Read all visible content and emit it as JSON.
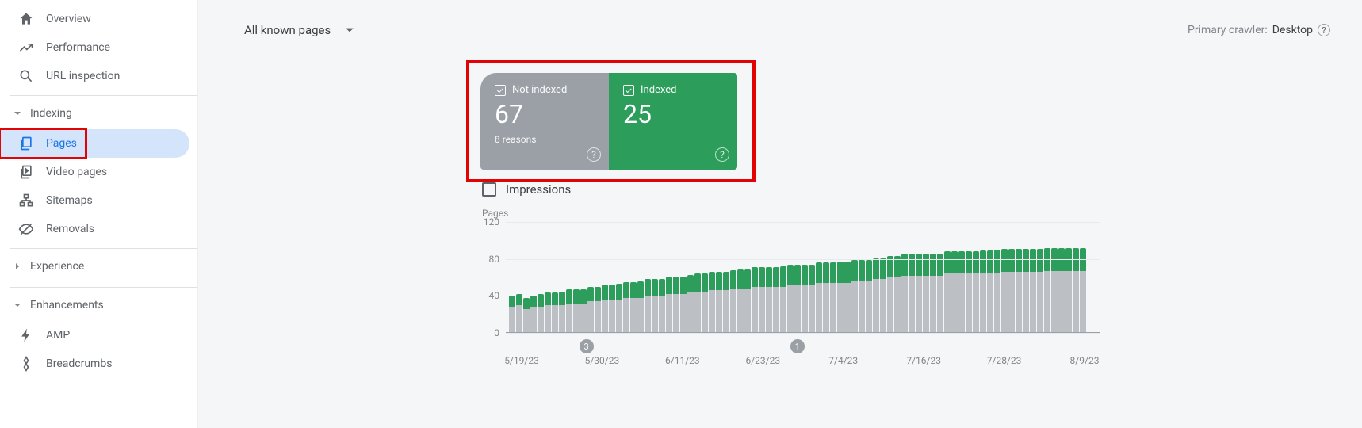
{
  "sidebar": {
    "items": [
      {
        "label": "Overview",
        "icon": "home"
      },
      {
        "label": "Performance",
        "icon": "trend"
      },
      {
        "label": "URL inspection",
        "icon": "search"
      }
    ],
    "indexing_label": "Indexing",
    "indexing_items": [
      {
        "label": "Pages",
        "icon": "pages",
        "selected": true
      },
      {
        "label": "Video pages",
        "icon": "video"
      },
      {
        "label": "Sitemaps",
        "icon": "sitemap"
      },
      {
        "label": "Removals",
        "icon": "removals"
      }
    ],
    "experience_label": "Experience",
    "enhancements_label": "Enhancements",
    "enhancements_items": [
      {
        "label": "AMP",
        "icon": "amp"
      },
      {
        "label": "Breadcrumbs",
        "icon": "breadcrumbs"
      }
    ]
  },
  "topbar": {
    "filter_label": "All known pages",
    "crawler_prefix": "Primary crawler:",
    "crawler_value": "Desktop"
  },
  "cards": {
    "not_indexed": {
      "title": "Not indexed",
      "value": "67",
      "sub": "8 reasons"
    },
    "indexed": {
      "title": "Indexed",
      "value": "25"
    }
  },
  "impressions_label": "Impressions",
  "chart_data": {
    "type": "bar",
    "title": "Pages",
    "ylabel": "Pages",
    "ylim": [
      0,
      120
    ],
    "yticks": [
      0,
      40,
      80,
      120
    ],
    "categories": [
      "5/19/23",
      "5/30/23",
      "6/11/23",
      "6/23/23",
      "7/4/23",
      "7/16/23",
      "7/28/23",
      "8/9/23"
    ],
    "markers": [
      {
        "x": 11,
        "label": "3"
      },
      {
        "x": 41,
        "label": "1"
      }
    ],
    "series": [
      {
        "name": "Indexed",
        "color": "#2d9d5c",
        "values": [
          12,
          12,
          12,
          12,
          14,
          14,
          14,
          15,
          15,
          15,
          15,
          16,
          16,
          16,
          16,
          17,
          17,
          17,
          18,
          18,
          18,
          18,
          19,
          19,
          19,
          19,
          20,
          20,
          20,
          20,
          20,
          20,
          21,
          21,
          21,
          21,
          21,
          21,
          22,
          22,
          22,
          22,
          22,
          22,
          22,
          22,
          23,
          23,
          23,
          23,
          23,
          23,
          23,
          23,
          23,
          24,
          24,
          24,
          24,
          24,
          24,
          24,
          24,
          24,
          24,
          24,
          24,
          24,
          25,
          25,
          25,
          25,
          25,
          25,
          25,
          25,
          25,
          25,
          25,
          25,
          25
        ]
      },
      {
        "name": "Not indexed",
        "color": "#bcbfc4",
        "values": [
          28,
          30,
          26,
          28,
          28,
          30,
          30,
          30,
          32,
          32,
          32,
          34,
          34,
          36,
          36,
          36,
          38,
          38,
          38,
          40,
          40,
          40,
          42,
          42,
          42,
          44,
          44,
          44,
          46,
          46,
          46,
          48,
          48,
          48,
          50,
          50,
          50,
          50,
          50,
          52,
          52,
          52,
          52,
          54,
          54,
          54,
          54,
          54,
          56,
          56,
          56,
          58,
          58,
          60,
          60,
          62,
          62,
          62,
          62,
          62,
          62,
          64,
          64,
          64,
          64,
          64,
          65,
          65,
          65,
          66,
          66,
          66,
          66,
          66,
          66,
          67,
          67,
          67,
          67,
          67,
          67
        ]
      }
    ]
  }
}
